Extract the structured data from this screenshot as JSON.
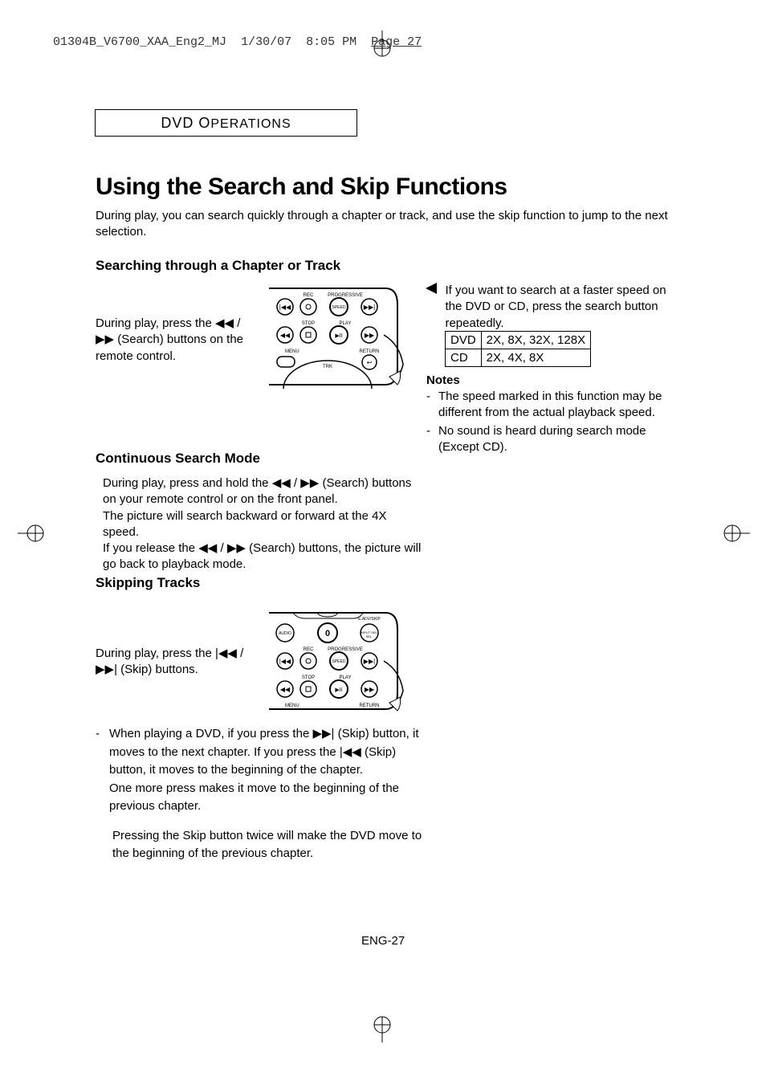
{
  "header_line": {
    "filename": "01304B_V6700_XAA_Eng2_MJ",
    "date": "1/30/07",
    "time": "8:05 PM",
    "page_label": "Page",
    "page_num": "27"
  },
  "section_label_prefix": "DVD O",
  "section_label_suffix": "PERATIONS",
  "page_title": "Using the Search and Skip Functions",
  "intro_text": "During play, you can search quickly through a chapter or track, and use the skip function to jump to the next selection.",
  "subheading1": "Searching through a Chapter or Track",
  "search_instruction_pre": "During play, press the ",
  "search_instruction_sym": "◀◀ / ▶▶",
  "search_instruction_post": " (Search) buttons on the remote control.",
  "right_text": "If you want to search at a faster speed on the DVD or CD, press the search button repeatedly.",
  "speed_table": {
    "rows": [
      {
        "label": "DVD",
        "value": "2X, 8X, 32X, 128X"
      },
      {
        "label": "CD",
        "value": "2X, 4X, 8X"
      }
    ]
  },
  "notes_heading": "Notes",
  "notes": [
    "The speed marked in this function may be different from the actual playback speed.",
    "No sound is heard during search mode (Except CD)."
  ],
  "subheading2": "Continuous Search Mode",
  "continuous_text_pre": "During play, press and hold the ",
  "continuous_text_sym1": "◀◀ / ▶▶",
  "continuous_text_mid1": " (Search) buttons on your remote control or on the front panel.",
  "continuous_text_line2": "The picture will search backward or forward at the 4X speed.",
  "continuous_text_line3_pre": "If you release the ",
  "continuous_text_sym2": "◀◀ / ▶▶",
  "continuous_text_line3_post": " (Search) buttons, the picture will go back to playback mode.",
  "subheading3": "Skipping Tracks",
  "skip_instruction_pre": "During play, press the ",
  "skip_instruction_sym": "|◀◀ / ▶▶|",
  "skip_instruction_post": " (Skip) buttons.",
  "skip_details_pre": "When playing a DVD, if you press the ",
  "skip_details_sym1": "▶▶|",
  "skip_details_mid1": " (Skip) button, it moves to the next chapter. If you press the ",
  "skip_details_sym2": "|◀◀",
  "skip_details_mid2": " (Skip) button, it moves to the beginning of the chapter.",
  "skip_details_line2": "One more press makes it move to the beginning of the previous chapter.",
  "skip_details_para2": "Pressing the Skip button twice will make the DVD move to the beginning of the previous chapter.",
  "page_number": "ENG-27",
  "remote_labels": {
    "rec": "REC",
    "progressive": "PROGRESSIVE",
    "stop": "STOP",
    "play": "PLAY",
    "menu": "MENU",
    "return": "RETURN",
    "trk": "TRK",
    "audio": "AUDIO",
    "speed": "SPEED",
    "eadvskip": "E.ADV/SKIP",
    "input": "INPUT SEL.",
    "zero": "0"
  }
}
